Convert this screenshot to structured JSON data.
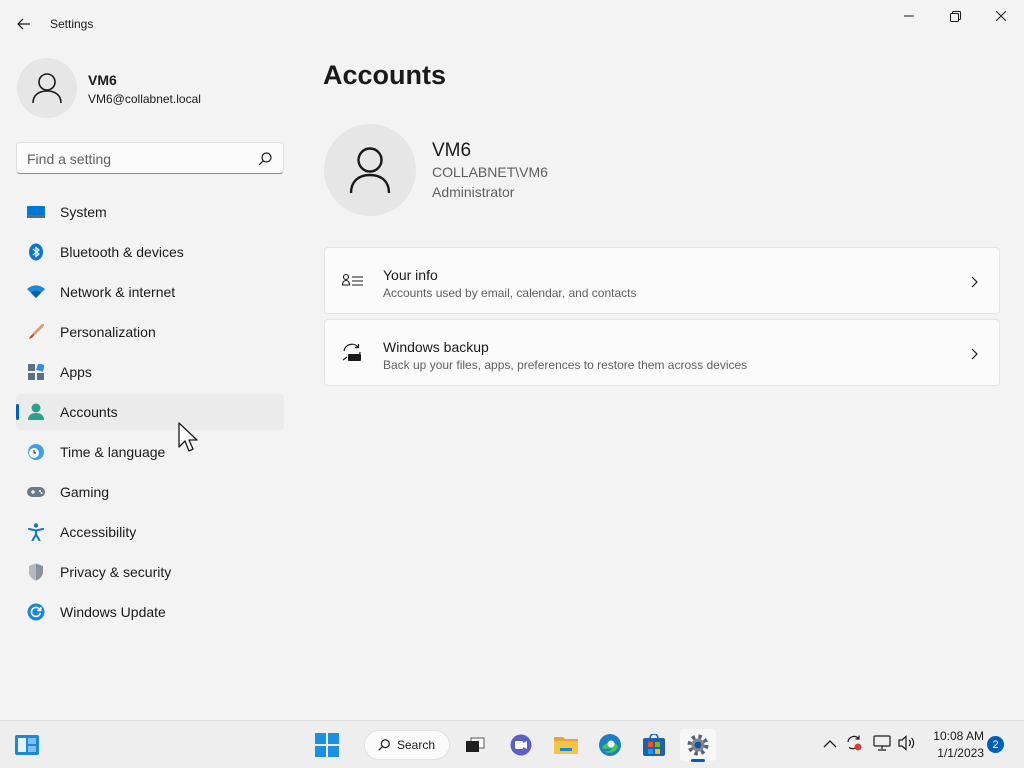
{
  "window": {
    "title": "Settings",
    "back_icon": "back-arrow-icon",
    "controls": [
      "minimize-icon",
      "restore-icon",
      "close-icon"
    ]
  },
  "profile": {
    "name": "VM6",
    "email": "VM6@collabnet.local",
    "avatar_icon": "person-icon"
  },
  "search": {
    "placeholder": "Find a setting",
    "icon": "search-icon"
  },
  "sidebar": {
    "active_index": 5,
    "items": [
      {
        "label": "System",
        "icon": "system-icon"
      },
      {
        "label": "Bluetooth & devices",
        "icon": "bluetooth-icon"
      },
      {
        "label": "Network & internet",
        "icon": "wifi-icon"
      },
      {
        "label": "Personalization",
        "icon": "brush-icon"
      },
      {
        "label": "Apps",
        "icon": "apps-icon"
      },
      {
        "label": "Accounts",
        "icon": "accounts-icon"
      },
      {
        "label": "Time & language",
        "icon": "time-language-icon"
      },
      {
        "label": "Gaming",
        "icon": "gamepad-icon"
      },
      {
        "label": "Accessibility",
        "icon": "accessibility-icon"
      },
      {
        "label": "Privacy & security",
        "icon": "shield-icon"
      },
      {
        "label": "Windows Update",
        "icon": "windows-update-icon"
      }
    ]
  },
  "main": {
    "title": "Accounts",
    "account": {
      "name": "VM6",
      "domain": "COLLABNET\\VM6",
      "role": "Administrator"
    },
    "cards": [
      {
        "title": "Your info",
        "description": "Accounts used by email, calendar, and contacts",
        "icon": "contact-info-icon"
      },
      {
        "title": "Windows backup",
        "description": "Back up your files, apps, preferences to restore them across devices",
        "icon": "backup-icon"
      }
    ]
  },
  "taskbar": {
    "search_label": "Search",
    "apps": [
      "widgets-icon",
      "start-icon",
      "search-icon",
      "task-view-icon",
      "chat-icon",
      "file-explorer-icon",
      "edge-icon",
      "store-icon",
      "settings-icon"
    ],
    "tray": [
      "chevron-up-icon",
      "sync-icon",
      "network-icon",
      "volume-icon"
    ],
    "time": "10:08 AM",
    "date": "1/1/2023",
    "notification_count": "2"
  },
  "colors": {
    "accent": "#005fb8",
    "background": "#f3f3f3",
    "card": "#fbfbfb"
  }
}
